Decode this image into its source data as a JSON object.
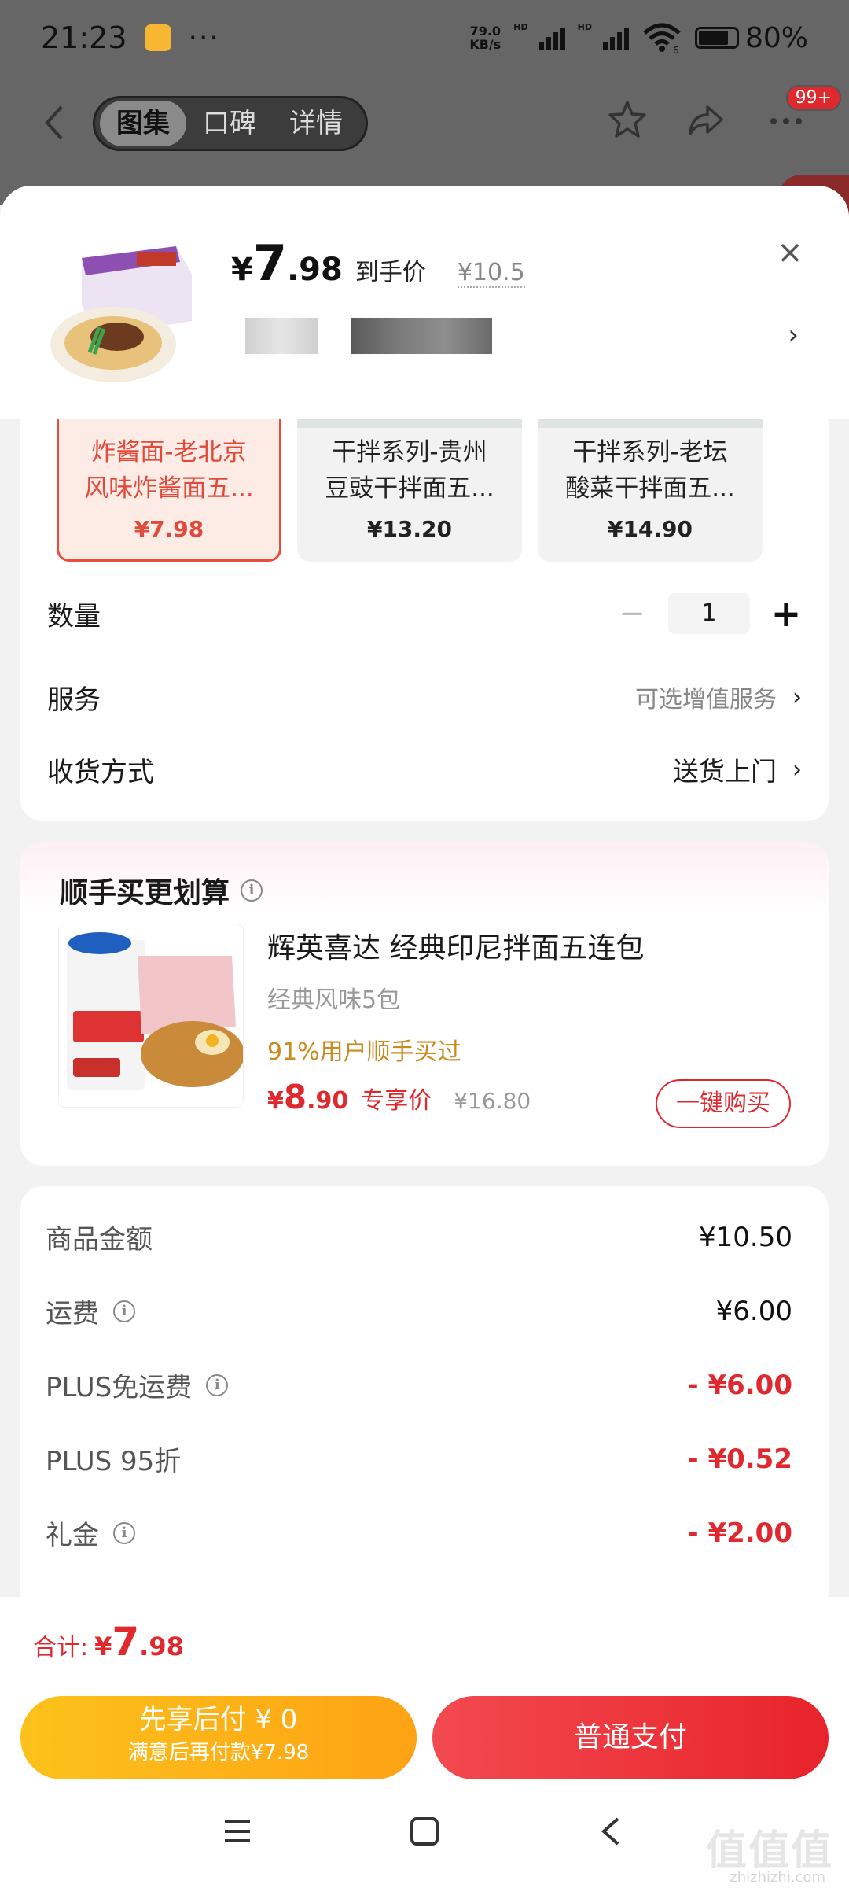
{
  "status_bar": {
    "time": "21:23",
    "dots": "···",
    "net_speed_value": "79.0",
    "net_speed_unit": "KB/s",
    "hd": "HD",
    "wifi_num": "6",
    "battery": "80%",
    "battery_level": 0.8
  },
  "nav": {
    "tabs": [
      "图集",
      "口碑",
      "详情"
    ],
    "active_tab": 0,
    "badge": "99+"
  },
  "product": {
    "price_symbol": "¥",
    "price_int": "7",
    "price_dec": ".98",
    "price_tag": "到手价",
    "original_price": "¥10.5",
    "close": "×",
    "chevron": "›"
  },
  "variants": [
    {
      "line1": "炸酱面-老北京",
      "line2": "风味炸酱面五...",
      "price": "¥7.98",
      "selected": true
    },
    {
      "line1": "干拌系列-贵州",
      "line2": "豆豉干拌面五...",
      "price": "¥13.20",
      "selected": false
    },
    {
      "line1": "干拌系列-老坛",
      "line2": "酸菜干拌面五...",
      "price": "¥14.90",
      "selected": false
    }
  ],
  "options": {
    "quantity_label": "数量",
    "quantity_value": "1",
    "minus": "−",
    "plus": "+",
    "service_label": "服务",
    "service_value": "可选增值服务",
    "delivery_label": "收货方式",
    "delivery_value": "送货上门",
    "chevron": "›"
  },
  "upsell": {
    "title": "顺手买更划算",
    "info": "i",
    "name": "辉英喜达 经典印尼拌面五连包",
    "spec": "经典风味5包",
    "social_proof": "91%用户顺手买过",
    "price_symbol": "¥",
    "price_int": "8",
    "price_dec": ".90",
    "price_tag": "专享价",
    "original_price": "¥16.80",
    "buy_button": "一键购买"
  },
  "summary": [
    {
      "label": "商品金额",
      "value": "¥10.50",
      "info": false,
      "red": false
    },
    {
      "label": "运费",
      "value": "¥6.00",
      "info": true,
      "red": false
    },
    {
      "label": "PLUS免运费",
      "value": "- ¥6.00",
      "info": true,
      "red": true
    },
    {
      "label": "PLUS 95折",
      "value": "- ¥0.52",
      "info": false,
      "red": true
    },
    {
      "label": "礼金",
      "value": "- ¥2.00",
      "info": true,
      "red": true
    }
  ],
  "bottom": {
    "total_label": "合计:",
    "total_symbol": "¥",
    "total_int": "7",
    "total_dec": ".98",
    "pay_later_line1": "先享后付 ¥ 0",
    "pay_later_line2": "满意后再付款¥7.98",
    "pay_button": "普通支付"
  },
  "watermark": {
    "text": "值值值",
    "url": "zhizhizhi.com"
  },
  "colors": {
    "accent_red": "#e0292e",
    "pay_later_yellow": "#fdb414",
    "social_gold": "#c98a1e"
  }
}
